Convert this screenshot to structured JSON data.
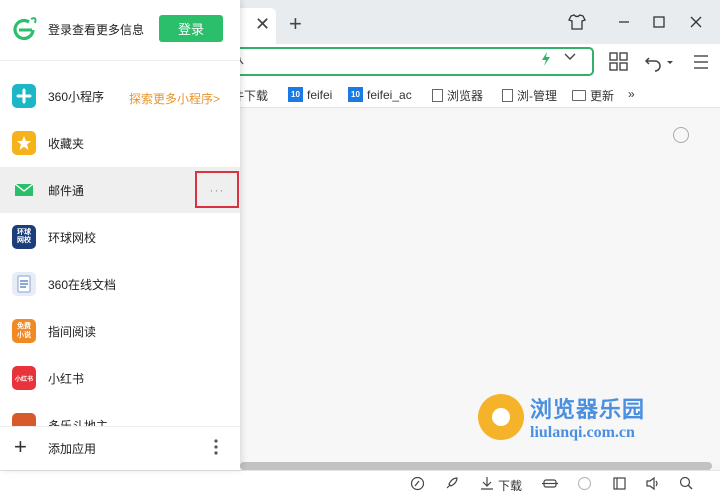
{
  "tab": {
    "close_glyph": "✕",
    "new_tab_glyph": "+"
  },
  "window": {
    "buttons": [
      "shirt-icon",
      "minimize-icon",
      "maximize-icon",
      "close-icon"
    ]
  },
  "address_bar": {
    "value": "",
    "icons": [
      "search-icon",
      "lightning-icon",
      "chevron-down-icon"
    ]
  },
  "bookmarks": [
    {
      "label": "件下载",
      "icon": "folder-icon"
    },
    {
      "label": "feifei",
      "icon": "site-favicon"
    },
    {
      "label": "feifei_ac",
      "icon": "site-favicon"
    },
    {
      "label": "浏览器",
      "icon": "page-icon"
    },
    {
      "label": "浏-管理",
      "icon": "page-icon"
    },
    {
      "label": "更新",
      "icon": "folder-icon"
    },
    {
      "label": "»",
      "icon": "overflow-icon"
    }
  ],
  "bookmark_fav_text": "10",
  "panel": {
    "login_tip": "登录查看更多信息",
    "login_button": "登录",
    "explore_link": "探索更多小程序>",
    "more_glyph": "···",
    "items": [
      {
        "label": "360小程序",
        "icon": "mini-program-icon",
        "color": "#1bb7c7"
      },
      {
        "label": "收藏夹",
        "icon": "star-icon",
        "color": "#f5b21b"
      },
      {
        "label": "邮件通",
        "icon": "mail-icon",
        "color": "#2bbf6b"
      },
      {
        "label": "环球网校",
        "icon": "school-icon",
        "color": "#1b3d7a"
      },
      {
        "label": "360在线文档",
        "icon": "document-icon",
        "color": "#e6edf7"
      },
      {
        "label": "指间阅读",
        "icon": "book-icon",
        "color": "#f08a24"
      },
      {
        "label": "小红书",
        "icon": "xiaohongshu-icon",
        "color": "#e8333a"
      },
      {
        "label": "多乐斗地主",
        "icon": "game-icon",
        "color": "#d85a2b"
      }
    ],
    "icon_text": {
      "school": "环球网校",
      "book": "免费小说",
      "xhs": "小红书"
    },
    "add_app": "添加应用"
  },
  "watermark": {
    "cn": "浏览器乐园",
    "en": "liulanqi.com.cn"
  },
  "statusbar": {
    "download_label": "下载"
  },
  "colors": {
    "accent": "#2bbf6b",
    "highlight": "#d9333f",
    "link": "#e8952b"
  }
}
